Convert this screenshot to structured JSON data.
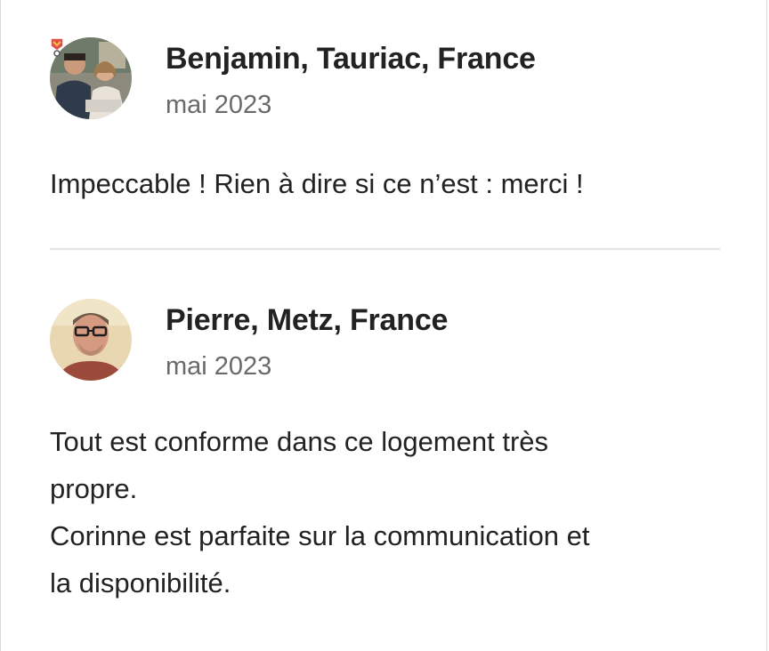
{
  "reviews": [
    {
      "name": "Benjamin, Tauriac, France",
      "date": "mai 2023",
      "text": "Impeccable ! Rien à dire si ce n’est : merci !",
      "avatar_icon": "user-photo-couple",
      "badge_icon": "superhost-badge-icon"
    },
    {
      "name": "Pierre, Metz, France",
      "date": "mai 2023",
      "text": "Tout est conforme dans ce logement très\npropre.\nCorinne est parfaite sur la communication et\nla disponibilité.",
      "avatar_icon": "user-photo-man-glasses"
    }
  ],
  "colors": {
    "name": "#222222",
    "date": "#6a6a6a",
    "divider": "#e3e3e3",
    "badge": "#e0504a"
  }
}
